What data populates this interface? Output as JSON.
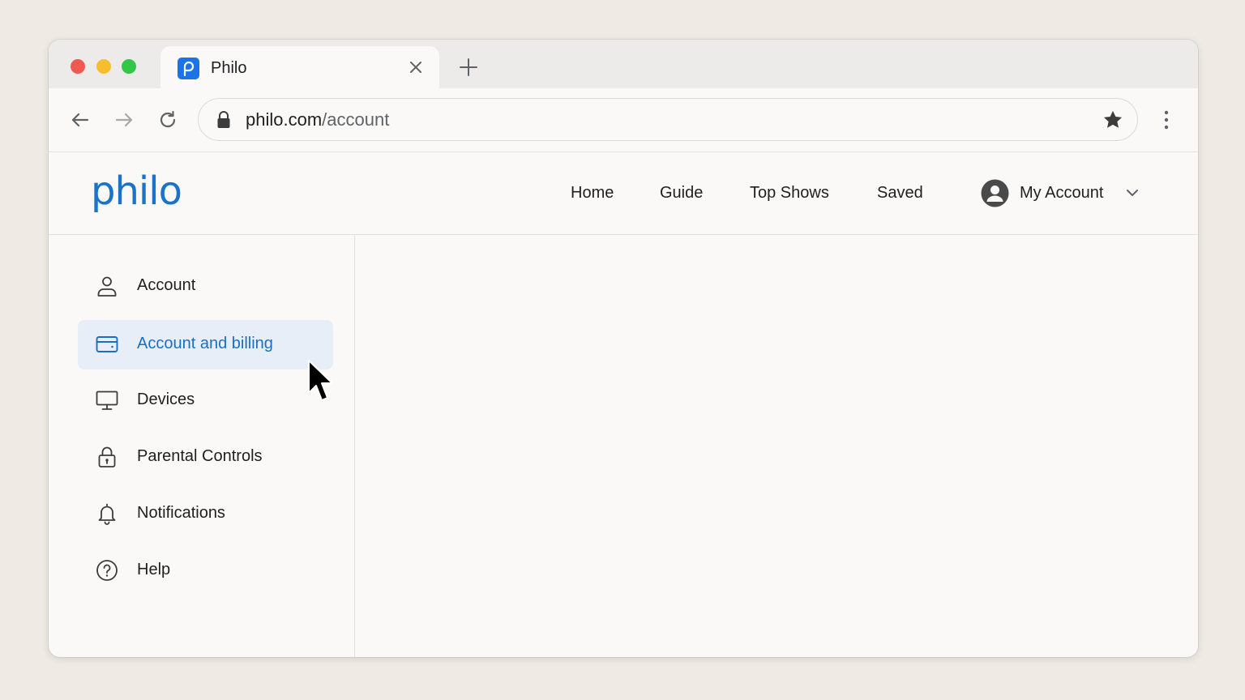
{
  "browser": {
    "tab": {
      "title": "Philo"
    },
    "address": {
      "domain": "philo.com",
      "path": "/account"
    }
  },
  "site": {
    "logo": "philo",
    "nav": [
      "Home",
      "Guide",
      "Top Shows",
      "Saved"
    ],
    "account_menu": "My Account"
  },
  "sidebar": {
    "items": [
      {
        "label": "Account",
        "icon": "person-icon",
        "active": false
      },
      {
        "label": "Account and billing",
        "icon": "credit-card-icon",
        "active": true
      },
      {
        "label": "Devices",
        "icon": "monitor-icon",
        "active": false
      },
      {
        "label": "Parental Controls",
        "icon": "lock-icon",
        "active": false
      },
      {
        "label": "Notifications",
        "icon": "bell-icon",
        "active": false
      },
      {
        "label": "Help",
        "icon": "help-circle-icon",
        "active": false
      }
    ]
  },
  "colors": {
    "brand": "#1a73c8",
    "active_bg": "#e8eef7",
    "page_bg": "#efebe4"
  }
}
